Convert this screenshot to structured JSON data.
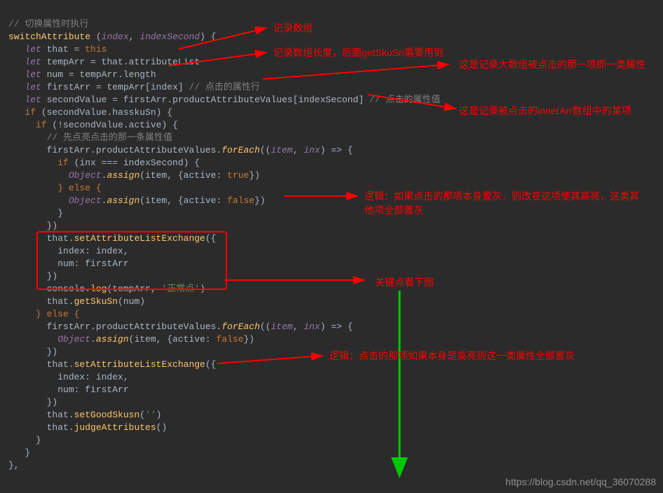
{
  "code": {
    "l1": "// 切换属性时执行",
    "l2_fn": "switchAttribute",
    "l2_p1": "index",
    "l2_p2": "indexSecond",
    "l3_kw": "let",
    "l3_v": "that",
    "l3_this": "this",
    "l4_kw": "let",
    "l4_v": "tempArr",
    "l4_rhs": "that.attributeList",
    "l5_kw": "let",
    "l5_v": "num",
    "l5_rhs": "tempArr.length",
    "l6_kw": "let",
    "l6_v": "firstArr",
    "l6_rhs": "tempArr[index]",
    "l6_c": "// 点击的属性行",
    "l7_kw": "let",
    "l7_v": "secondValue",
    "l7_rhs": "firstArr.productAttributeValues[indexSecond]",
    "l7_c": "// 点击的属性值",
    "l8_if": "if",
    "l8_cond": "secondValue.hasskuSn",
    "l9_if": "if",
    "l9_not": "!",
    "l9_cond": "secondValue.active",
    "l10_c": "// 先点亮点击的那一条属性值",
    "l11_lhs": "firstArr.productAttributeValues",
    "l11_fe": "forEach",
    "l11_p1": "item",
    "l11_p2": "inx",
    "l12_if": "if",
    "l12_cond": "inx === indexSecond",
    "l13_obj": "Object",
    "l13_as": "assign",
    "l13_args": "(item, {active: ",
    "l13_true": "true",
    "l13_close": "})",
    "l14_else": "} else {",
    "l15_obj": "Object",
    "l15_as": "assign",
    "l15_args": "(item, {active: ",
    "l15_false": "false",
    "l15_close": "})",
    "l16_cb": "}",
    "l17_cb": "})",
    "l18_call": "that.",
    "l18_m": "setAttributeListExchange",
    "l18_open": "({",
    "l19": "index: index,",
    "l20": "num: firstArr",
    "l21": "})",
    "l22_a": "console.",
    "l22_m": "log",
    "l22_args": "(tempArr, ",
    "l22_str": "'正常点'",
    "l22_end": ")",
    "l23_a": "that.",
    "l23_m": "getSkuSn",
    "l23_args": "(num)",
    "l24": "} else {",
    "l25_lhs": "firstArr.productAttributeValues",
    "l25_fe": "forEach",
    "l25_p1": "item",
    "l25_p2": "inx",
    "l26_obj": "Object",
    "l26_as": "assign",
    "l26_args": "(item, {active: ",
    "l26_false": "false",
    "l26_close": "})",
    "l27": "})",
    "l28_a": "that.",
    "l28_m": "setAttributeListExchange",
    "l28_open": "({",
    "l29": "index: index,",
    "l30": "num: firstArr",
    "l31": "})",
    "l32_a": "that.",
    "l32_m": "setGoodSkusn",
    "l32_args": "(",
    "l32_str": "''",
    "l32_end": ")",
    "l33_a": "that.",
    "l33_m": "judgeAttributes",
    "l33_args": "()",
    "l34": "}",
    "l35": "}",
    "l36": "},"
  },
  "annotations": {
    "a1": "记录数组",
    "a2": "记录数组长度，后面getSkuSn需要用到",
    "a3": "这是记录大数组被点击的那一项即一类属性",
    "a4": "这是记录被点击的innerArr数组中的某项",
    "a5": "逻辑：如果点击的那项本身置灰，则改变这项使其高亮，这类其他项全部置灰",
    "a6": "关键点看下图",
    "a7": "逻辑：点击的那项如果本身是高亮则这一类属性全部置灰"
  },
  "watermark": "https://blog.csdn.net/qq_36070288"
}
